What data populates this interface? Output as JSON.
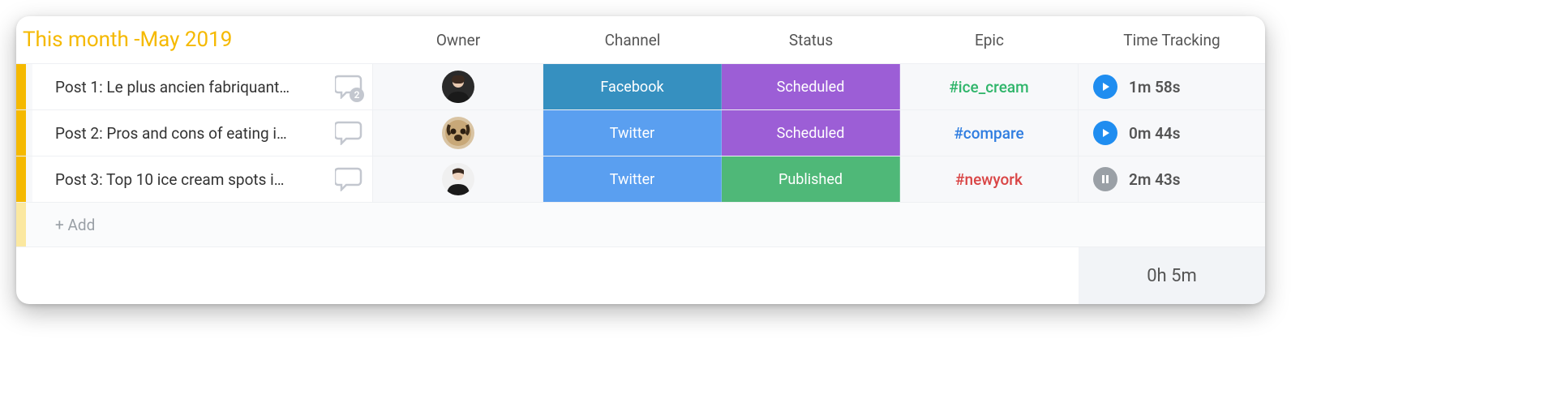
{
  "group": {
    "title": "This month -May 2019"
  },
  "columns": {
    "owner": "Owner",
    "channel": "Channel",
    "status": "Status",
    "epic": "Epic",
    "time": "Time Tracking"
  },
  "colors": {
    "accent": "#f5b900",
    "facebook": "#3690c0",
    "twitter": "#5a9ff0",
    "scheduled": "#9c5ed6",
    "published": "#4fb878",
    "epic_green": "#2fb56a",
    "epic_blue": "#2f7de0",
    "epic_red": "#d94545",
    "play": "#1f8df0",
    "pause": "#9aa0a6"
  },
  "rows": [
    {
      "name": "Post 1: Le plus ancien fabriquant…",
      "comments": 2,
      "owner": "person-1",
      "channel": {
        "label": "Facebook",
        "color": "#3690c0"
      },
      "status": {
        "label": "Scheduled",
        "color": "#9c5ed6"
      },
      "epic": {
        "label": "#ice_cream",
        "color": "#2fb56a"
      },
      "time": {
        "state": "play",
        "value": "1m 58s"
      }
    },
    {
      "name": "Post 2: Pros and cons of eating i…",
      "comments": 0,
      "owner": "pug",
      "channel": {
        "label": "Twitter",
        "color": "#5a9ff0"
      },
      "status": {
        "label": "Scheduled",
        "color": "#9c5ed6"
      },
      "epic": {
        "label": "#compare",
        "color": "#2f7de0"
      },
      "time": {
        "state": "play",
        "value": "0m 44s"
      }
    },
    {
      "name": "Post 3: Top 10 ice cream spots i…",
      "comments": 0,
      "owner": "person-2",
      "channel": {
        "label": "Twitter",
        "color": "#5a9ff0"
      },
      "status": {
        "label": "Published",
        "color": "#4fb878"
      },
      "epic": {
        "label": "#newyork",
        "color": "#d94545"
      },
      "time": {
        "state": "pause",
        "value": "2m 43s"
      }
    }
  ],
  "add_label": "+ Add",
  "total_time": "0h 5m"
}
